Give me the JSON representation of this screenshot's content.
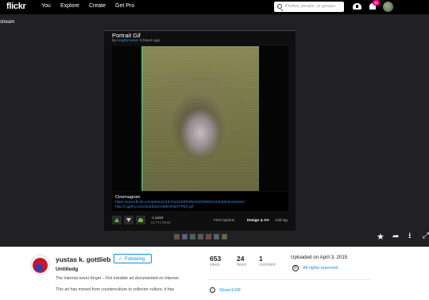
{
  "nav": {
    "logo": "flickr",
    "links": [
      "You",
      "Explore",
      "Create",
      "Get Pro"
    ],
    "search_placeholder": "Photos, people, or groups",
    "notification_count": "31"
  },
  "back_link": "stream",
  "post": {
    "title": "Portrait Gif",
    "by": "by",
    "author": "imgsbrowser",
    "time": "3 hours ago",
    "desc_title": "Cinemagram",
    "desc_link1": "https://www.flickr.com/photos/48734423@N05/16200662044/in/photostream/",
    "desc_link2": "http://i.giphy.com/3oEdvaCeMEVK9jT7P6S.gif",
    "points": "-1 point",
    "views": "22,774 views",
    "options": [
      "First Options",
      "Design & Art",
      "Add tag"
    ]
  },
  "actions": {
    "thumb_colors": [
      "#7a4b3a",
      "#5b5f9e",
      "#3c6f4e",
      "#5a5a5a",
      "#8a3a3a",
      "#4a6a8a",
      "#6b6b3a"
    ]
  },
  "info": {
    "author_name": "yustas k. gottlieb",
    "follow_label": "Following",
    "follow_check": "✓",
    "photo_title": "Untitledg",
    "desc_line1": "The Internet never forget – Fist invisible art documented on Internet",
    "desc_line2": "This art has moved from counterculture to collector culture, it has",
    "stats": [
      {
        "num": "653",
        "label": "views"
      },
      {
        "num": "24",
        "label": "faves"
      },
      {
        "num": "1",
        "label": "comment"
      }
    ],
    "uploaded": "Uploaded on April 3, 2015",
    "cc_symbol": "©",
    "rights": "All rights reserved",
    "info_symbol": "i",
    "exif": "Show EXIF"
  }
}
